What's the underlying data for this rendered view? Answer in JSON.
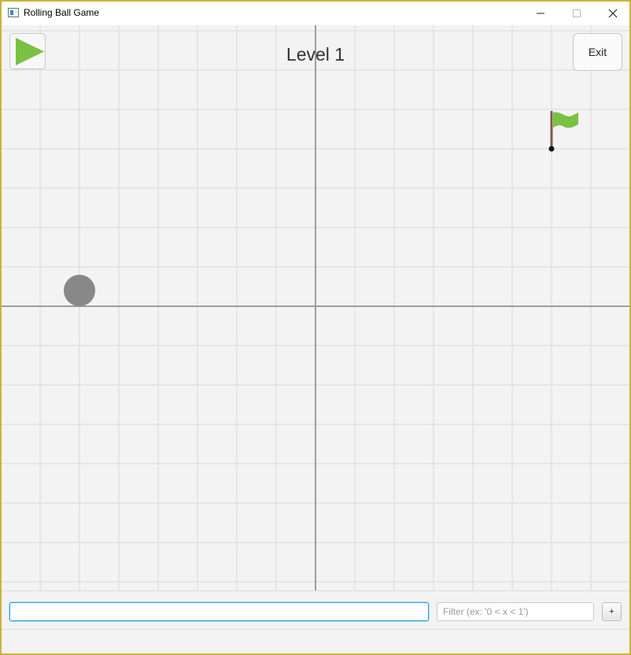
{
  "window": {
    "title": "Rolling Ball Game",
    "controls": {
      "minimize_icon": "minimize-icon",
      "maximize_icon": "maximize-icon",
      "close_icon": "close-icon"
    }
  },
  "game": {
    "level_title": "Level 1",
    "exit_label": "Exit",
    "play_icon": "play-icon",
    "grid_spacing_units": 1,
    "ball": {
      "x": -6,
      "y": 0.4,
      "color": "#888888"
    },
    "goal_flag": {
      "x": 6,
      "y": 4,
      "flag_color": "#7ac143",
      "pole_color": "#7a5c4a"
    },
    "colors": {
      "background": "#f3f3f3",
      "grid": "#d8d8d8",
      "axis": "#9e9e9e",
      "play_triangle": "#7ac143"
    }
  },
  "controls": {
    "function_input": {
      "value": "",
      "placeholder": ""
    },
    "filter_input": {
      "value": "",
      "placeholder": "Filter (ex: '0 < x < 1')"
    },
    "add_label": "+"
  }
}
